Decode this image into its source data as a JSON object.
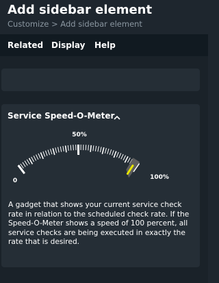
{
  "header": {
    "title": "Add sidebar element",
    "breadcrumb": "Customize > Add sidebar element"
  },
  "menu": {
    "items": [
      "Related",
      "Display",
      "Help"
    ]
  },
  "snapin": {
    "title": "Service Speed-O-Meter",
    "toggle_icon": "chevron-up-icon",
    "description": "A gadget that shows your current service check rate in relation to the scheduled check rate. If the Speed-O-Meter shows a speed of 100 percent, all service checks are being executed in exactly the rate that is desired."
  },
  "speedometer": {
    "label_min": "0",
    "label_mid": "50%",
    "label_max": "100%",
    "needle_percent": 97,
    "target_zone_percent": [
      94,
      100
    ]
  },
  "colors": {
    "background": "#1a2229",
    "panel": "#252e36",
    "menubar": "#111a21",
    "needle": "#e8e600",
    "scale": "#ffffff"
  }
}
